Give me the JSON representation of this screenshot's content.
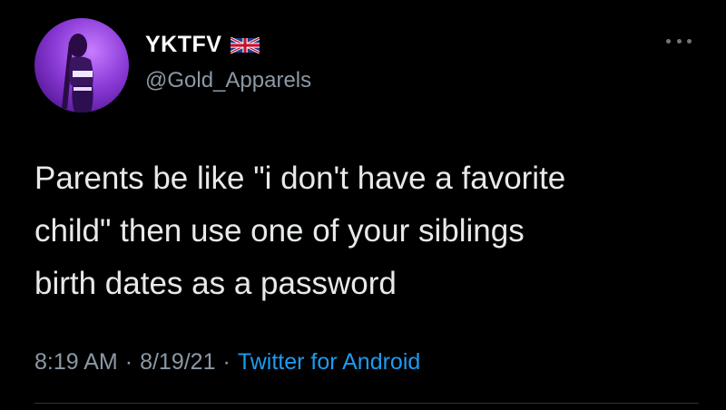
{
  "tweet": {
    "display_name": "YKTFV",
    "flag_icon": "uk-flag-icon",
    "handle": "@Gold_Apparels",
    "more_icon": "more-dots-icon",
    "text": "Parents be like \"i don't have a favorite\nchild\" then use one of your siblings\nbirth dates as a password",
    "time": "8:19 AM",
    "separator_1": "·",
    "date": "8/19/21",
    "separator_2": "·",
    "source": "Twitter for Android"
  },
  "colors": {
    "background": "#000000",
    "text": "#e7e9ea",
    "secondary": "#8b98a5",
    "link": "#1d9bf0",
    "avatar_accent": "#8a3ad6"
  }
}
